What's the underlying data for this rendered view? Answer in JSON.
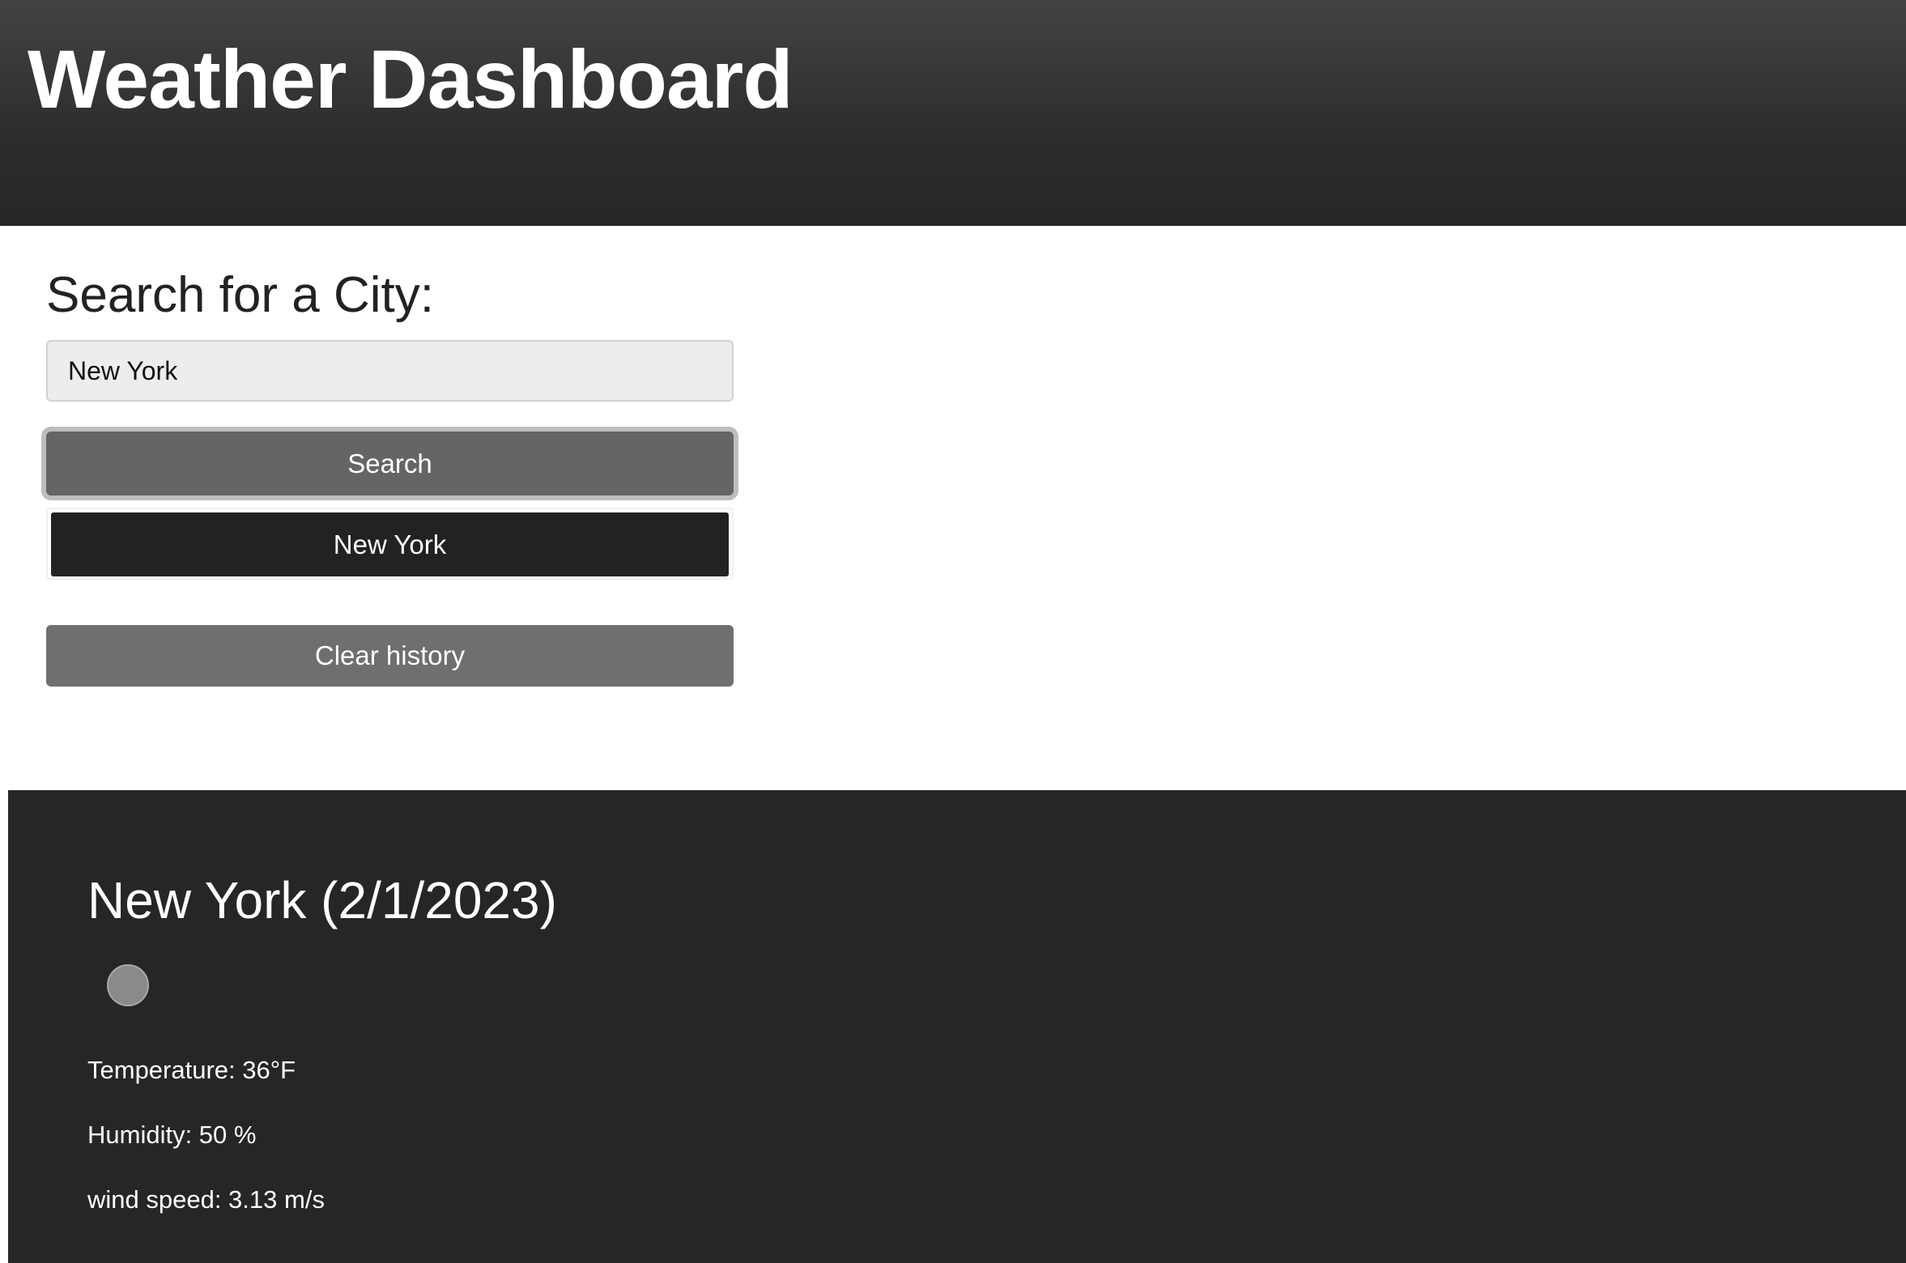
{
  "header": {
    "title": "Weather Dashboard"
  },
  "search": {
    "heading": "Search for a City:",
    "input_value": "New York",
    "button_label": "Search"
  },
  "history": {
    "items": [
      "New York"
    ],
    "clear_label": "Clear history"
  },
  "current_weather": {
    "title": "New York (2/1/2023)",
    "icon": "weather-condition-icon",
    "temperature": "Temperature: 36°F",
    "humidity": "Humidity: 50 %",
    "wind_speed": "wind speed: 3.13 m/s"
  },
  "colors": {
    "header_bg": "#2d2d2d",
    "panel_bg": "#262626",
    "search_button": "#656565",
    "history_button": "#222222",
    "clear_button": "#6f6f6f"
  }
}
